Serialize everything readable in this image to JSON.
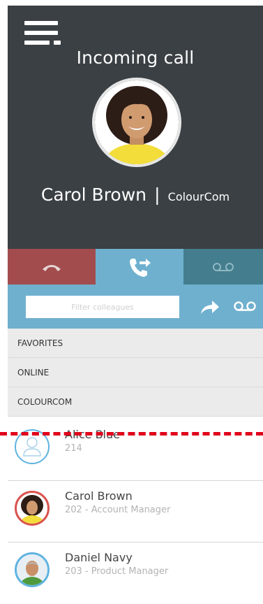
{
  "header": {
    "title": "Incoming call",
    "caller_name": "Carol Brown",
    "separator": "|",
    "caller_company": "ColourCom"
  },
  "actions": {
    "decline_icon": "hang-up-icon",
    "transfer_icon": "call-transfer-icon",
    "voicemail_icon": "voicemail-icon"
  },
  "filter": {
    "placeholder": "Filter colleagues",
    "forward_icon": "forward-arrow-icon",
    "voicemail_icon": "voicemail-icon"
  },
  "sections": [
    "FAVORITES",
    "ONLINE",
    "COLOURCOM"
  ],
  "contacts": [
    {
      "name": "Alice Blue",
      "detail": "214",
      "status_color": "#5fb3e0"
    },
    {
      "name": "Carol Brown",
      "detail": "202 - Account Manager",
      "status_color": "#d9534f"
    },
    {
      "name": "Daniel Navy",
      "detail": "203 - Product Manager",
      "status_color": "#5fb3e0"
    }
  ],
  "colors": {
    "header_bg": "#3b4044",
    "decline": "#a24c4d",
    "transfer": "#6fb0cf",
    "voicemail": "#447e8e",
    "filter_bar": "#6fb0cf",
    "dashed_line": "#e0001a"
  }
}
